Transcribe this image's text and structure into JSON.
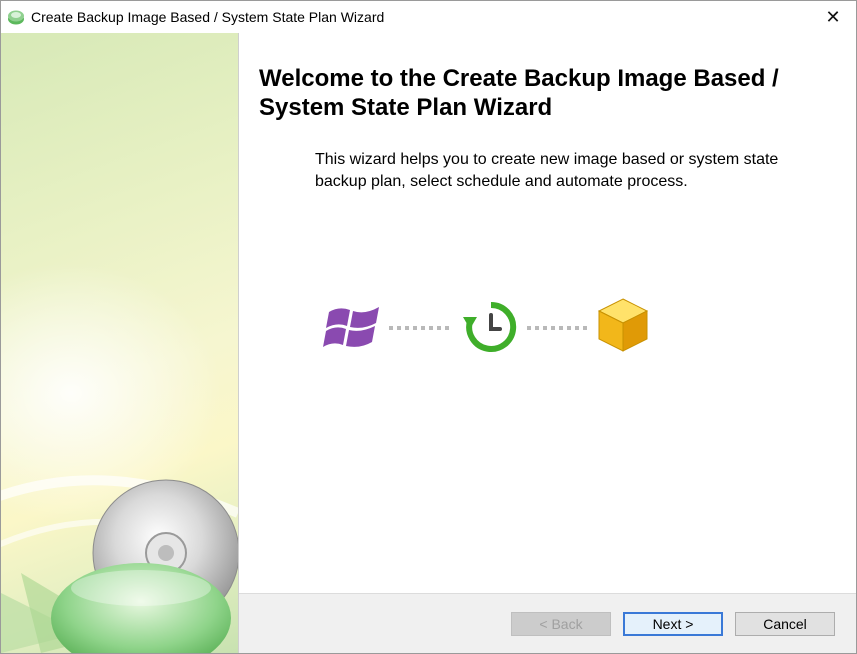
{
  "window": {
    "title": "Create Backup Image Based / System State Plan Wizard",
    "close_glyph": "✕"
  },
  "main": {
    "heading": "Welcome to the Create Backup Image Based / System State Plan Wizard",
    "description": "This wizard helps you to create new image based or system state backup plan, select schedule and automate process."
  },
  "flow": {
    "icons": [
      "windows-logo-icon",
      "schedule-clock-icon",
      "storage-cube-icon"
    ],
    "colors": {
      "windows": "#8a4ab0",
      "clock": "#3fae2a",
      "cube": "#f2b71a",
      "dots": "#b9b9b9"
    }
  },
  "footer": {
    "back_label": "< Back",
    "next_label": "Next >",
    "cancel_label": "Cancel"
  }
}
